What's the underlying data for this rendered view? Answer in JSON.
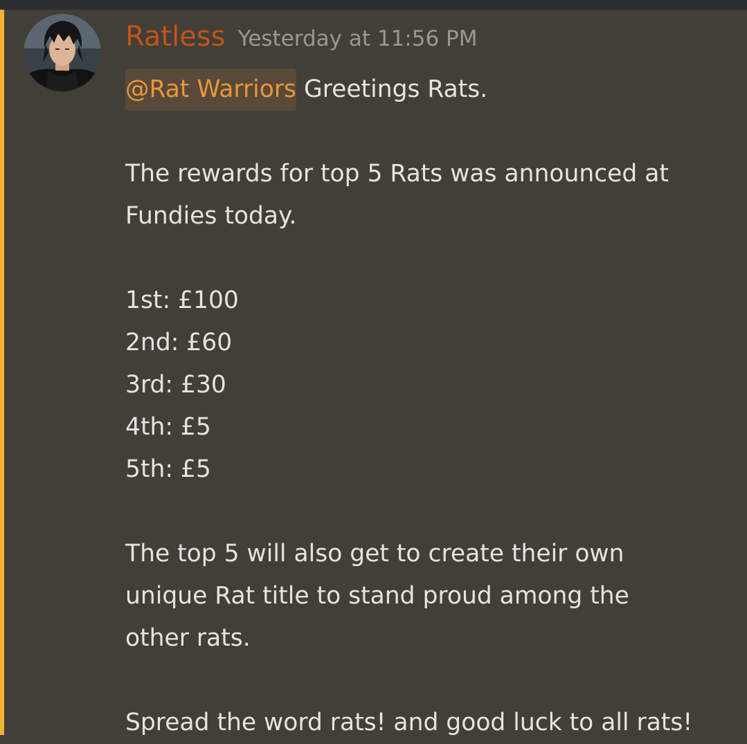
{
  "message": {
    "username": "Ratless",
    "timestamp": "Yesterday at 11:56 PM",
    "mention": "@Rat Warriors",
    "lines": [
      " Greetings Rats.",
      "",
      "The rewards for top 5 Rats was announced at",
      "Fundies today.",
      "",
      "1st: £100",
      "2nd: £60",
      "3rd: £30",
      "4th: £5",
      "5th: £5",
      "",
      "The top 5 will also get to create their own",
      "unique Rat title to stand proud among the",
      "other rats.",
      "",
      "Spread the word rats! and good luck to all rats!"
    ]
  },
  "colors": {
    "background": "#423e38",
    "highlight_bar": "#f0b232",
    "username": "#c0541a",
    "timestamp": "#9a9892",
    "body_text": "#e6e4de",
    "mention_text": "#e8973a",
    "mention_bg": "#58493a"
  },
  "icons": {
    "avatar": "user-avatar-image"
  }
}
